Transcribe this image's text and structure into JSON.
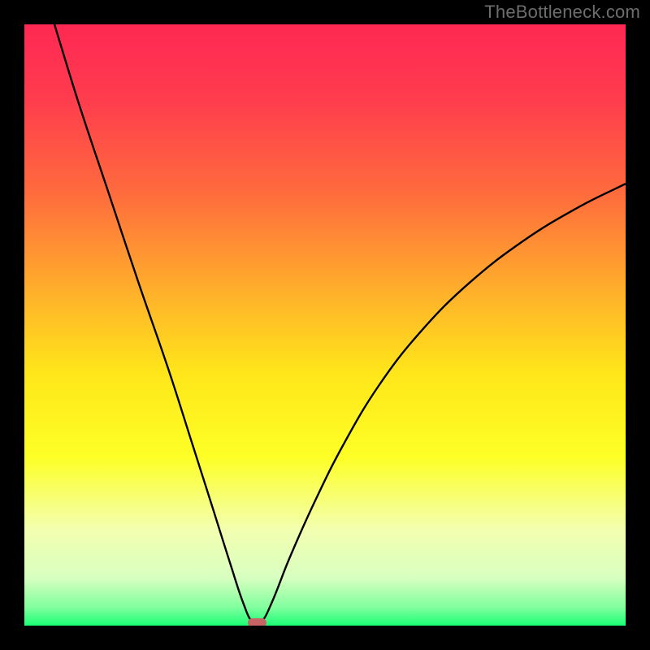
{
  "watermark": "TheBottleneck.com",
  "chart_data": {
    "type": "line",
    "title": "",
    "xlabel": "",
    "ylabel": "",
    "x_range": [
      0,
      100
    ],
    "y_range_percent": [
      0,
      100
    ],
    "background_gradient_stops": [
      {
        "pct": 0,
        "color": "#ff2853"
      },
      {
        "pct": 12,
        "color": "#ff3b4e"
      },
      {
        "pct": 28,
        "color": "#ff6b3d"
      },
      {
        "pct": 45,
        "color": "#ffb22a"
      },
      {
        "pct": 58,
        "color": "#ffe61a"
      },
      {
        "pct": 72,
        "color": "#fdff26"
      },
      {
        "pct": 84,
        "color": "#f3ffb0"
      },
      {
        "pct": 92,
        "color": "#d8ffc0"
      },
      {
        "pct": 97,
        "color": "#80ff9e"
      },
      {
        "pct": 100,
        "color": "#1aff74"
      }
    ],
    "series": [
      {
        "name": "bottleneck-curve",
        "color": "#000000",
        "points": [
          {
            "x": 5.0,
            "y": 100.0
          },
          {
            "x": 9.0,
            "y": 87.0
          },
          {
            "x": 14.0,
            "y": 72.0
          },
          {
            "x": 19.0,
            "y": 57.0
          },
          {
            "x": 24.0,
            "y": 42.5
          },
          {
            "x": 28.0,
            "y": 30.0
          },
          {
            "x": 31.5,
            "y": 19.0
          },
          {
            "x": 34.5,
            "y": 9.5
          },
          {
            "x": 36.5,
            "y": 3.5
          },
          {
            "x": 38.0,
            "y": 0.5
          },
          {
            "x": 39.3,
            "y": 0.5
          },
          {
            "x": 41.0,
            "y": 3.5
          },
          {
            "x": 44.0,
            "y": 11.0
          },
          {
            "x": 48.0,
            "y": 20.0
          },
          {
            "x": 53.0,
            "y": 30.0
          },
          {
            "x": 59.0,
            "y": 40.0
          },
          {
            "x": 66.0,
            "y": 49.0
          },
          {
            "x": 74.0,
            "y": 57.0
          },
          {
            "x": 83.0,
            "y": 64.0
          },
          {
            "x": 92.0,
            "y": 69.5
          },
          {
            "x": 100.0,
            "y": 73.5
          }
        ]
      }
    ],
    "marker": {
      "name": "optimal-range",
      "x_center": 38.7,
      "y": 0.5,
      "width_pct": 3.2,
      "height_pct": 1.5,
      "color": "#c86464"
    }
  }
}
